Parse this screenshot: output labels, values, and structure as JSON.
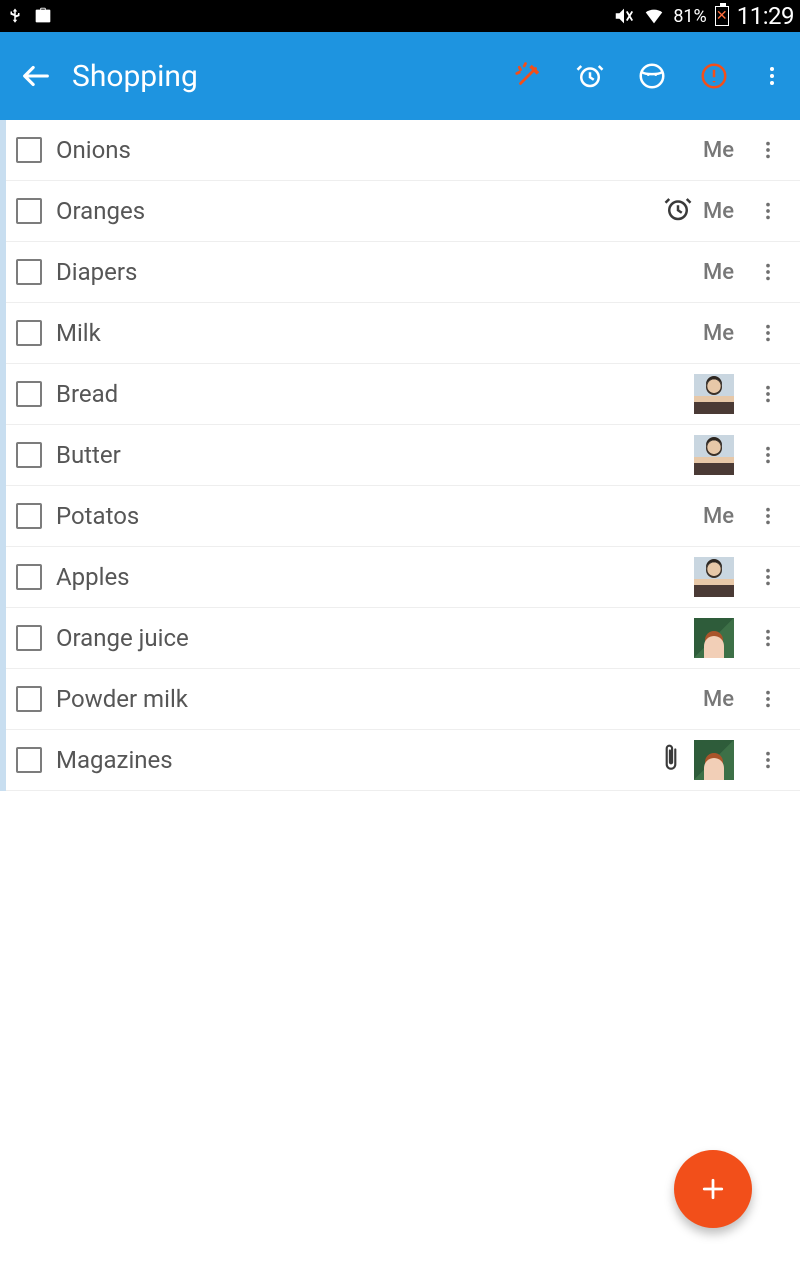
{
  "status": {
    "battery_pct": "81%",
    "time": "11:29"
  },
  "appbar": {
    "title": "Shopping"
  },
  "assignees": {
    "me": "Me"
  },
  "list": {
    "items": [
      {
        "label": "Onions",
        "assignee": "me",
        "has_alarm": false,
        "has_attach": false
      },
      {
        "label": "Oranges",
        "assignee": "me",
        "has_alarm": true,
        "has_attach": false
      },
      {
        "label": "Diapers",
        "assignee": "me",
        "has_alarm": false,
        "has_attach": false
      },
      {
        "label": "Milk",
        "assignee": "me",
        "has_alarm": false,
        "has_attach": false
      },
      {
        "label": "Bread",
        "assignee": "man",
        "has_alarm": false,
        "has_attach": false
      },
      {
        "label": "Butter",
        "assignee": "man",
        "has_alarm": false,
        "has_attach": false
      },
      {
        "label": "Potatos",
        "assignee": "me",
        "has_alarm": false,
        "has_attach": false
      },
      {
        "label": "Apples",
        "assignee": "man",
        "has_alarm": false,
        "has_attach": false
      },
      {
        "label": "Orange juice",
        "assignee": "woman",
        "has_alarm": false,
        "has_attach": false
      },
      {
        "label": "Powder milk",
        "assignee": "me",
        "has_alarm": false,
        "has_attach": false
      },
      {
        "label": "Magazines",
        "assignee": "woman",
        "has_alarm": false,
        "has_attach": true
      }
    ]
  },
  "colors": {
    "primary": "#1e94e0",
    "accent": "#f24f1a"
  }
}
